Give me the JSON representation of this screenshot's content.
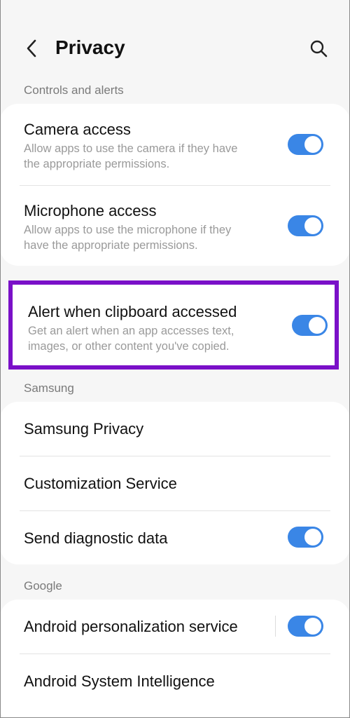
{
  "header": {
    "back_icon": "chevron-left-icon",
    "title": "Privacy",
    "search_icon": "search-icon"
  },
  "sections": {
    "controls_label": "Controls and alerts",
    "samsung_label": "Samsung",
    "google_label": "Google"
  },
  "controls": {
    "camera": {
      "title": "Camera access",
      "desc_line1": "Allow apps to use the camera if they have",
      "desc_line2": "the appropriate permissions.",
      "enabled": true
    },
    "microphone": {
      "title": "Microphone access",
      "desc_line1": "Allow apps to use the microphone if they",
      "desc_line2": "have the appropriate permissions.",
      "enabled": true
    },
    "clipboard": {
      "title": "Alert when clipboard accessed",
      "desc_line1": "Get an alert when an app accesses text,",
      "desc_line2": "images, or other content you've copied.",
      "enabled": true
    }
  },
  "samsung": {
    "privacy": "Samsung Privacy",
    "customization": "Customization Service",
    "diagnostic": {
      "title": "Send diagnostic data",
      "enabled": true
    }
  },
  "google": {
    "personalization": {
      "title": "Android personalization service",
      "enabled": true
    },
    "intelligence": "Android System Intelligence"
  },
  "colors": {
    "toggle_on": "#3a86e6",
    "highlight_border": "#7a10c8"
  }
}
